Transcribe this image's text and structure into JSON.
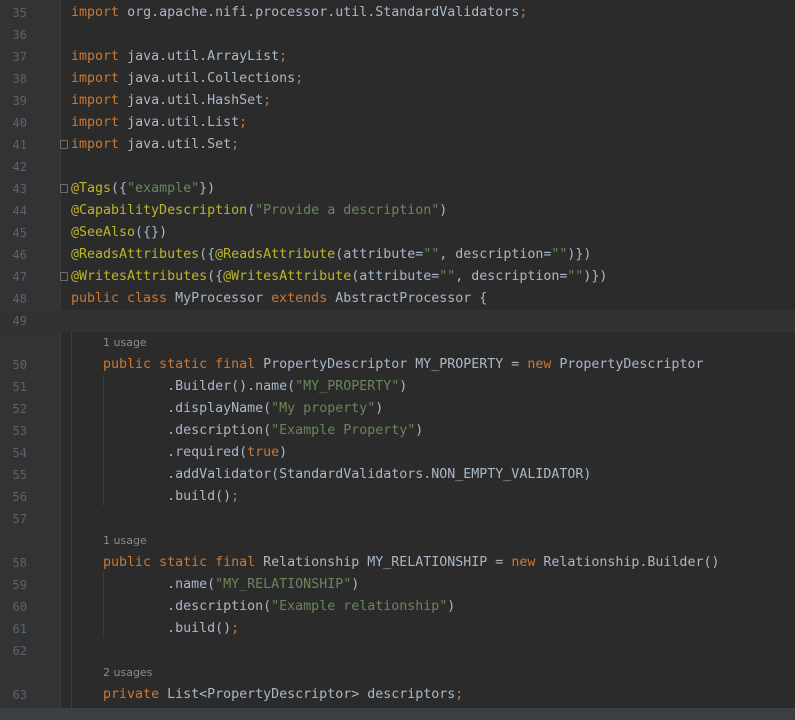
{
  "lines": [
    {
      "n": "35",
      "kind": "import",
      "kw": "import",
      "name": "org.apache.nifi.processor.util.StandardValidators",
      "semi": ";"
    },
    {
      "n": "36",
      "kind": "blank"
    },
    {
      "n": "37",
      "kind": "import",
      "kw": "import",
      "name": "java.util.ArrayList",
      "semi": ";"
    },
    {
      "n": "38",
      "kind": "import",
      "kw": "import",
      "name": "java.util.Collections",
      "semi": ";"
    },
    {
      "n": "39",
      "kind": "import",
      "kw": "import",
      "name": "java.util.HashSet",
      "semi": ";"
    },
    {
      "n": "40",
      "kind": "import",
      "kw": "import",
      "name": "java.util.List",
      "semi": ";"
    },
    {
      "n": "41",
      "kind": "import",
      "kw": "import",
      "name": "java.util.Set",
      "semi": ";"
    },
    {
      "n": "42",
      "kind": "blank"
    },
    {
      "n": "43",
      "kind": "tags",
      "ann": "@Tags",
      "open": "({",
      "str": "\"example\"",
      "close": "})"
    },
    {
      "n": "44",
      "kind": "capability",
      "ann": "@CapabilityDescription",
      "open": "(",
      "str": "\"Provide a description\"",
      "close": ")"
    },
    {
      "n": "45",
      "kind": "seealso",
      "ann": "@SeeAlso",
      "rest": "({})"
    },
    {
      "n": "46",
      "kind": "reads",
      "ann": "@ReadsAttributes",
      "t1": "({",
      "ann2": "@ReadsAttribute",
      "t2": "(attribute=",
      "s1": "\"\"",
      "t3": ", description=",
      "s2": "\"\"",
      "t4": ")})"
    },
    {
      "n": "47",
      "kind": "writes",
      "ann": "@WritesAttributes",
      "t1": "({",
      "ann2": "@WritesAttribute",
      "t2": "(attribute=",
      "s1": "\"\"",
      "t3": ", description=",
      "s2": "\"\"",
      "t4": ")})"
    },
    {
      "n": "48",
      "kind": "classdecl",
      "kw1": "public class ",
      "name": "MyProcessor ",
      "kw2": "extends ",
      "super": "AbstractProcessor {"
    },
    {
      "n": "49",
      "kind": "blank"
    },
    {
      "n": "50",
      "kind": "propdecl",
      "hint": "1 usage",
      "kw": "public static final ",
      "t1": "PropertyDescriptor MY_PROPERTY = ",
      "kw2": "new ",
      "t2": "PropertyDescriptor"
    },
    {
      "n": "51",
      "kind": "call",
      "indent": "        ",
      "t1": ".Builder().name(",
      "s": "\"MY_PROPERTY\"",
      "t2": ")"
    },
    {
      "n": "52",
      "kind": "call",
      "indent": "        ",
      "t1": ".displayName(",
      "s": "\"My property\"",
      "t2": ")"
    },
    {
      "n": "53",
      "kind": "call",
      "indent": "        ",
      "t1": ".description(",
      "s": "\"Example Property\"",
      "t2": ")"
    },
    {
      "n": "54",
      "kind": "callkw",
      "indent": "        ",
      "t1": ".required(",
      "kw": "true",
      "t2": ")"
    },
    {
      "n": "55",
      "kind": "plain",
      "indent": "        ",
      "t1": ".addValidator(StandardValidators.NON_EMPTY_VALIDATOR)"
    },
    {
      "n": "56",
      "kind": "build",
      "indent": "        ",
      "t1": ".build()",
      "semi": ";"
    },
    {
      "n": "57",
      "kind": "blank"
    },
    {
      "n": "58",
      "kind": "reldecl",
      "hint": "1 usage",
      "kw": "public static final ",
      "t1": "Relationship MY_RELATIONSHIP = ",
      "kw2": "new ",
      "t2": "Relationship.Builder()"
    },
    {
      "n": "59",
      "kind": "call",
      "indent": "        ",
      "t1": ".name(",
      "s": "\"MY_RELATIONSHIP\"",
      "t2": ")"
    },
    {
      "n": "60",
      "kind": "call",
      "indent": "        ",
      "t1": ".description(",
      "s": "\"Example relationship\"",
      "t2": ")"
    },
    {
      "n": "61",
      "kind": "build",
      "indent": "        ",
      "t1": ".build()",
      "semi": ";"
    },
    {
      "n": "62",
      "kind": "blank"
    },
    {
      "n": "63",
      "kind": "field",
      "hint": "2 usages",
      "kw": "private ",
      "t1": "List<PropertyDescriptor> descriptors",
      "semi": ";"
    }
  ],
  "colors": {
    "background": "#2b2b2b",
    "gutter": "#313335",
    "keyword": "#cc7832",
    "string": "#6a8759",
    "annotation": "#bbb529",
    "text": "#a9b7c6",
    "line_number": "#606366",
    "current_line": "#323232"
  },
  "current_line": "49"
}
